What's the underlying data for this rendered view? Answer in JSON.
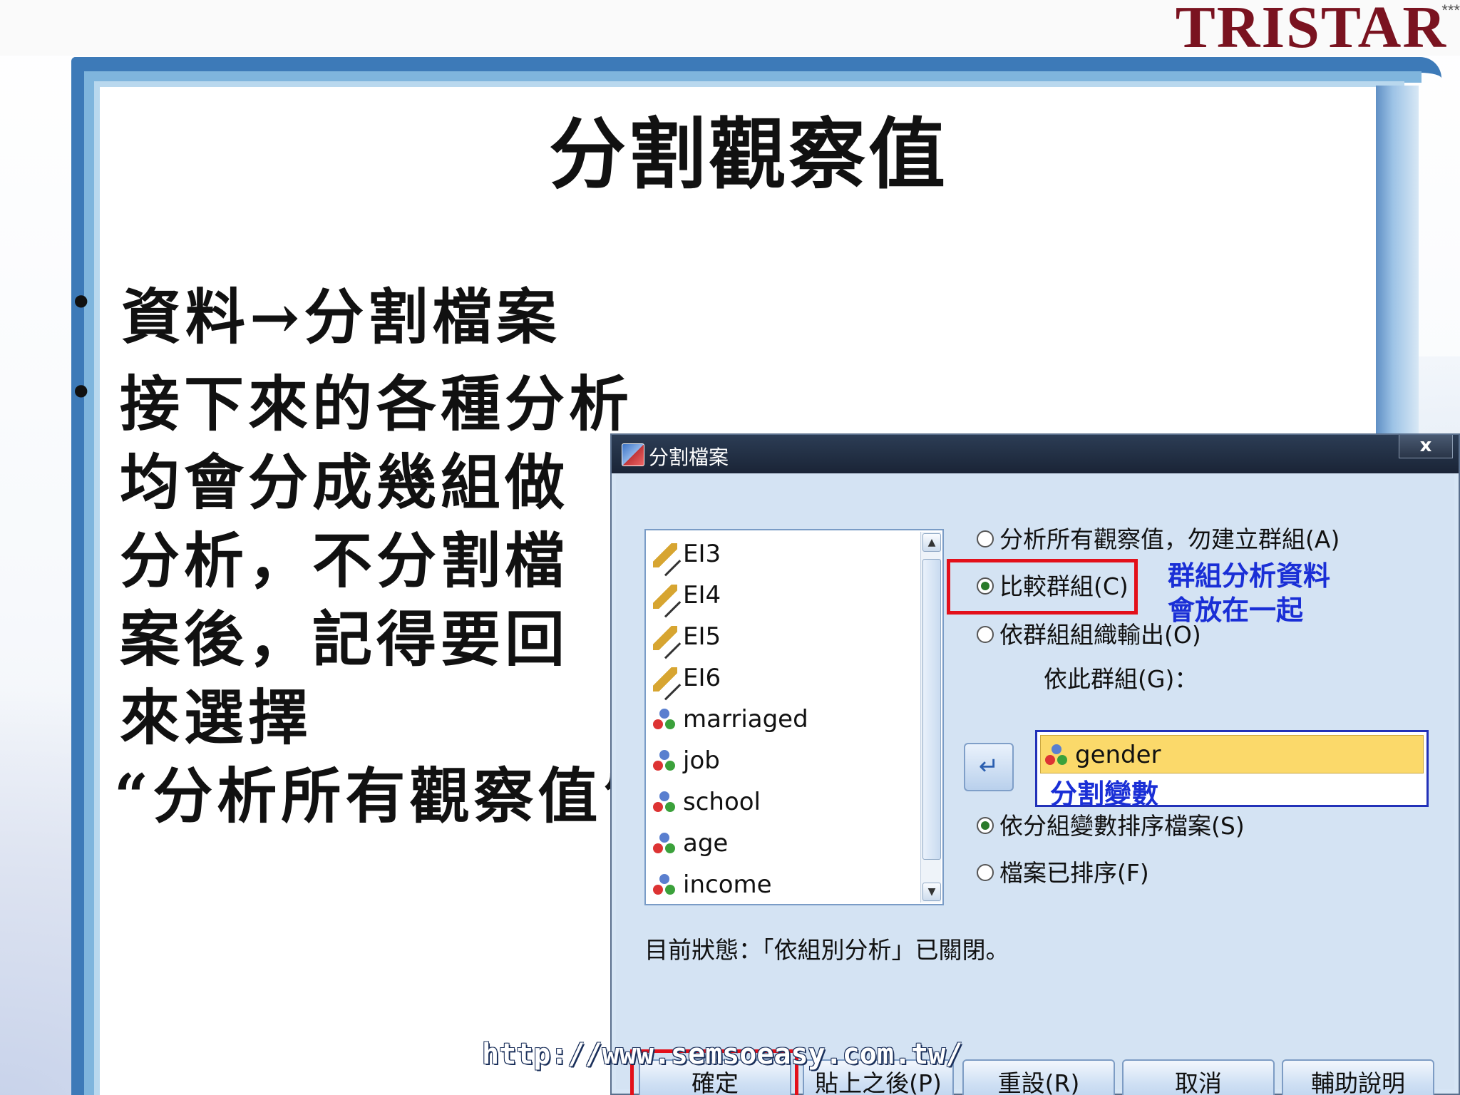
{
  "brand": {
    "name": "TRISTAR",
    "stars": "***"
  },
  "slide": {
    "title": "分割觀察值",
    "bullet1": "資料→分割檔案",
    "bullet2_lines": [
      "接下來的各種分析",
      "均會分成幾組做",
      "分析，不分割檔",
      "案後，記得要回",
      "來選擇",
      "“分析所有觀察值”"
    ],
    "bullet_symbol": "•",
    "url": "http://www.semsoeasy.com.tw/"
  },
  "dialog": {
    "title": "分割檔案",
    "close_label": "x",
    "variables": [
      {
        "name": "EI3",
        "icon": "scale-ruler-icon"
      },
      {
        "name": "EI4",
        "icon": "scale-ruler-icon"
      },
      {
        "name": "EI5",
        "icon": "scale-ruler-icon"
      },
      {
        "name": "EI6",
        "icon": "scale-ruler-icon"
      },
      {
        "name": "marriaged",
        "icon": "nominal-icon"
      },
      {
        "name": "job",
        "icon": "nominal-icon"
      },
      {
        "name": "school",
        "icon": "nominal-icon"
      },
      {
        "name": "age",
        "icon": "nominal-icon"
      },
      {
        "name": "income",
        "icon": "nominal-icon"
      }
    ],
    "options": {
      "analyze_all": "分析所有觀察值，勿建立群組(A)",
      "compare_groups": "比較群組(C)",
      "organize_output": "依群組組織輸出(O)",
      "selected": "compare_groups"
    },
    "group_label": "依此群組(G)：",
    "group_variable": "gender",
    "sort_options": {
      "sort_by_group": "依分組變數排序檔案(S)",
      "already_sorted": "檔案已排序(F)",
      "selected": "sort_by_group"
    },
    "status": "目前狀態：「依組別分析」已關閉。",
    "buttons": {
      "ok": "確定",
      "paste": "貼上之後(P)",
      "reset": "重設(R)",
      "cancel": "取消",
      "help": "輔助說明"
    }
  },
  "annotations": {
    "compare_note_line1": "群組分析資料",
    "compare_note_line2": "會放在一起",
    "split_variable_note": "分割變數",
    "highlight_color": "#e3101a",
    "note_color": "#1a2fd6"
  }
}
